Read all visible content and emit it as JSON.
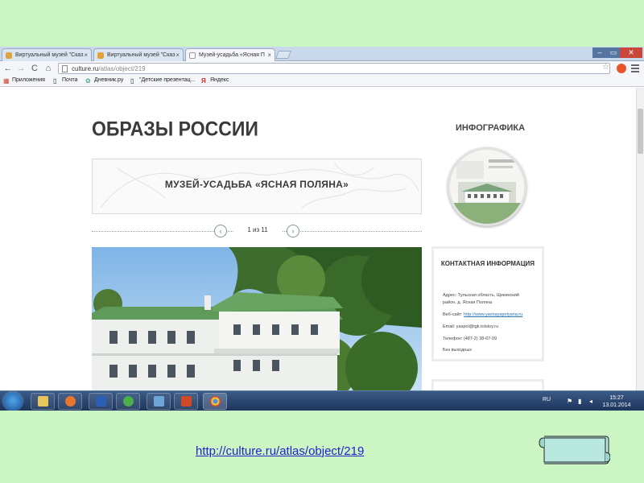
{
  "browser": {
    "tabs": [
      {
        "label": "Виртуальный музей \"Сказ",
        "active": false
      },
      {
        "label": "Виртуальный музей \"Сказ",
        "active": false
      },
      {
        "label": "Музей-усадьба «Ясная П",
        "active": true
      }
    ],
    "url": {
      "domain": "culture.ru",
      "path": "/atlas/object/219"
    },
    "bookmarks": [
      "Приложения",
      "Почта",
      "Дневник.ру",
      "\"Детские презентац...",
      "Яндекс"
    ]
  },
  "page": {
    "site_title": "ОБРАЗЫ РОССИИ",
    "infographic_title": "ИНФОГРАФИКА",
    "banner_title": "МУЗЕЙ-УСАДЬБА «ЯСНАЯ ПОЛЯНА»",
    "pager": {
      "text": "1 из 11",
      "prev_icon": "chevron-left-icon",
      "next_icon": "chevron-right-icon"
    },
    "contact": {
      "title": "КОНТАКТНАЯ ИНФОРМАЦИЯ",
      "address_line1": "Адрес: Тульская область, Щекинский",
      "address_line2": "район, д. Ясная Поляна",
      "website_label": "Веб-сайт:",
      "website": "http://www.yasnayapolyana.ru",
      "email": "Email: yaspol@tgk.tolstoy.ru",
      "phone": "Телефон: (487-2) 38-67-09",
      "hours": "Без выходных"
    }
  },
  "taskbar": {
    "lang": "RU",
    "time": "15:27",
    "date": "13.01.2014",
    "apps": [
      "explorer-icon",
      "media-player-icon",
      "word-icon",
      "mail-icon",
      "browser-icon",
      "presentation-icon",
      "chrome-icon"
    ]
  },
  "footer": {
    "link": "http://culture.ru/atlas/object/219"
  },
  "colors": {
    "slide_background": "#ccf5c4",
    "link": "#2222cc",
    "scroll_button": "#b8e8e0",
    "pager_accent": "#5c8a6b"
  }
}
